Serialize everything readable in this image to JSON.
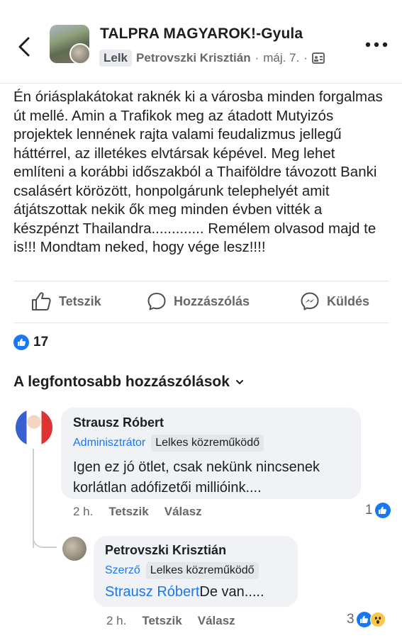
{
  "header": {
    "group_name": "TALPRA MAGYAROK!-Gyula",
    "badge": "Lelk",
    "author": "Petrovszki Krisztián",
    "date": "máj. 7.",
    "separator": "·"
  },
  "post": {
    "text": "Én óriásplakátokat raknék ki a városba minden forgalmas út mellé. Amin a Trafikok meg az átadott Mutyizós projektek lennének rajta valami feudalizmus jellegű háttérrel, az illetékes elvtársak képével. Meg lehet említeni a korábbi időszakból a Thaiföldre távozott Banki csalásért körözött, honpolgárunk telephelyét amit átjátszottak nekik ők meg minden évben vitték a készpénzt Thailandra............. Remélem olvasod majd te is!!! Mondtam neked, hogy vége lesz!!!!"
  },
  "actions": {
    "like": "Tetszik",
    "comment": "Hozzászólás",
    "send": "Küldés"
  },
  "reactions": {
    "count": "17"
  },
  "comments_section": {
    "sort_label": "A legfontosabb hozzászólások"
  },
  "comments": [
    {
      "name": "Strausz Róbert",
      "role": "Adminisztrátor",
      "badge": "Lelkes közreműködő",
      "text": "Igen ez jó ötlet, csak nekünk nincsenek korlátlan adófizetői millióink....",
      "time": "2 h.",
      "like": "Tetszik",
      "reply": "Válasz",
      "reaction_count": "1"
    },
    {
      "name": "Petrovszki Krisztián",
      "role": "Szerző",
      "badge": "Lelkes közreműködő",
      "mention": "Strausz Róbert",
      "text": "De van.....",
      "time": "2 h.",
      "like": "Tetszik",
      "reply": "Válasz",
      "reaction_count": "3"
    }
  ],
  "colors": {
    "accent": "#1877f2",
    "text": "#1c1e21",
    "muted": "#65676b",
    "bubble": "#f0f2f5"
  }
}
